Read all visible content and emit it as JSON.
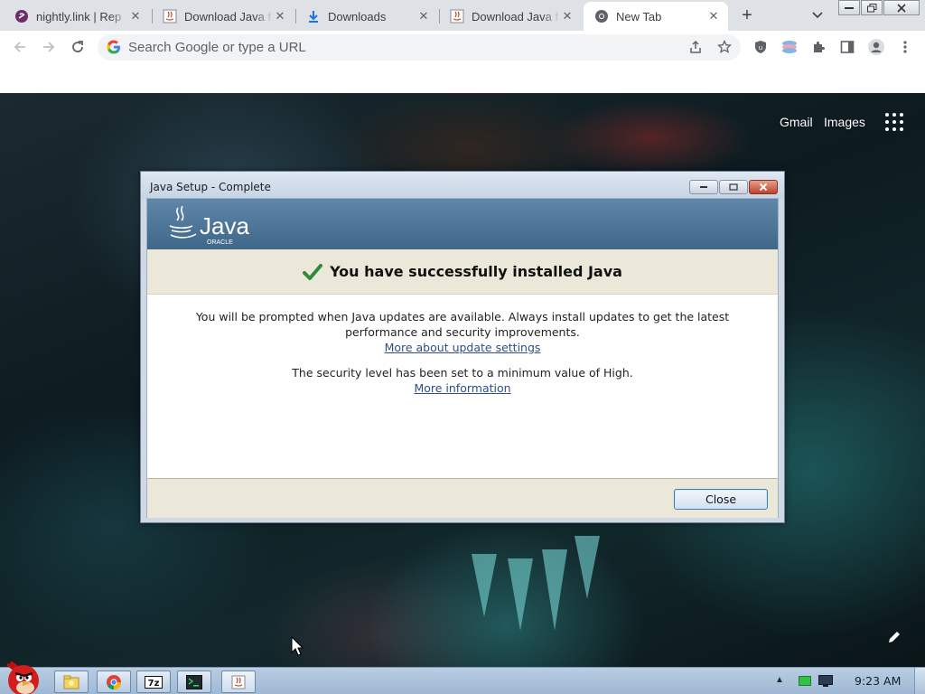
{
  "browser": {
    "tabs": [
      {
        "label": "nightly.link | Rep",
        "icon": "nightly-link-icon"
      },
      {
        "label": "Download Java f",
        "icon": "java-page-icon"
      },
      {
        "label": "Downloads",
        "icon": "download-icon"
      },
      {
        "label": "Download Java f",
        "icon": "java-page-icon"
      },
      {
        "label": "New Tab",
        "icon": "chrome-icon",
        "active": true
      }
    ],
    "omnibox": {
      "placeholder": "Search Google or type a URL",
      "value": ""
    }
  },
  "ntp": {
    "links": {
      "gmail": "Gmail",
      "images": "Images"
    }
  },
  "dialog": {
    "title": "Java Setup - Complete",
    "logo": {
      "wordmark": "Java",
      "sub": "ORACLE"
    },
    "success": "You have successfully installed Java",
    "update_text": "You will be prompted when Java updates are available. Always install updates to get the latest performance and security improvements.",
    "update_link": "More about update settings",
    "security_text": "The security level has been set to a minimum value of High.",
    "security_link": "More information",
    "close_label": "Close"
  },
  "taskbar": {
    "clock": "9:23 AM",
    "items": [
      "file-explorer",
      "chrome",
      "7zip",
      "terminal",
      "java-installer"
    ],
    "item_labels": {
      "sevenzip": "7z"
    }
  },
  "colors": {
    "java_banner": "#4b7396",
    "success_check": "#2e8b3a",
    "link": "#2f4f85",
    "taskbar": "#aec4dc"
  }
}
